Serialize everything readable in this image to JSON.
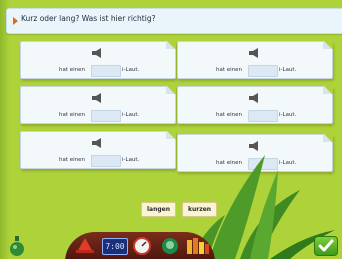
{
  "prompt": "Kurz oder lang? Was ist hier richtig?",
  "cards": [
    {
      "before": "hat einen",
      "after": "i-Laut."
    },
    {
      "before": "hat einen",
      "after": "i-Laut."
    },
    {
      "before": "hat einen",
      "after": "i-Laut."
    },
    {
      "before": "hat einen",
      "after": "i-Laut."
    },
    {
      "before": "hat einen",
      "after": "i-Laut."
    },
    {
      "before": "hat einen",
      "after": "i-Laut."
    }
  ],
  "answers": {
    "long": "langen",
    "short": "kurzen"
  },
  "toolbar": {
    "clock_label": "7:00"
  },
  "colors": {
    "background": "#aed23a",
    "card": "#f3f8fb",
    "slot": "#dce9f4",
    "toolbar": "#6b2416"
  }
}
